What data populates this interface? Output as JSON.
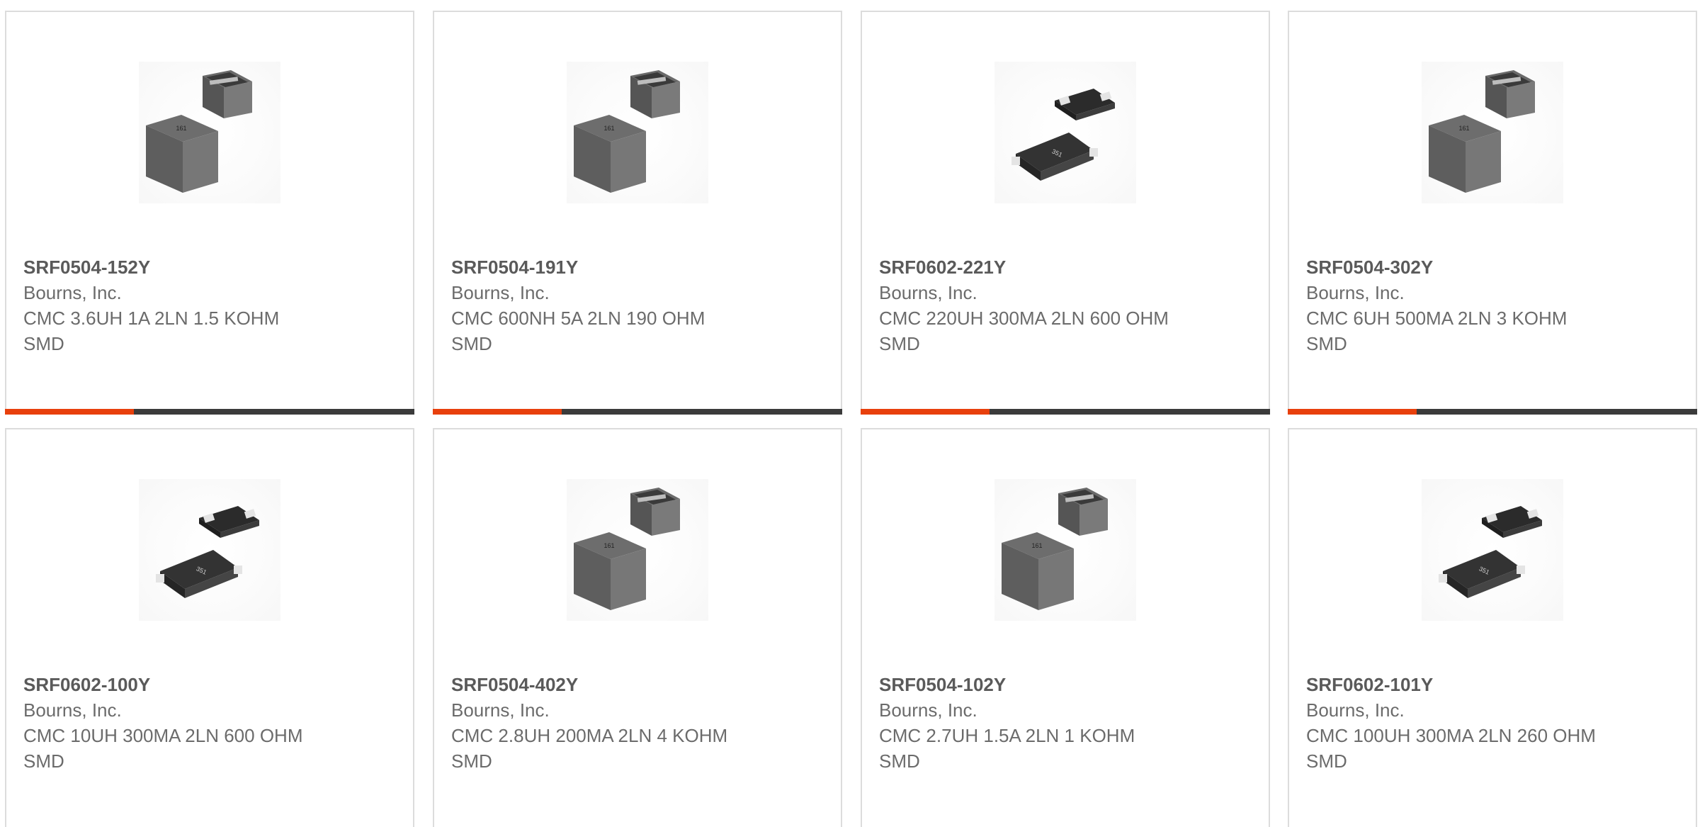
{
  "colors": {
    "accent": "#e8400c",
    "track": "#3b3b3b",
    "border": "#dcdcdc",
    "text": "#6b6b6b"
  },
  "products": [
    {
      "part_number": "SRF0504-152Y",
      "manufacturer": "Bourns, Inc.",
      "description": "CMC 3.6UH 1A 2LN 1.5 KOHM SMD",
      "image_icon": "inductor-cube-icon",
      "image_marking": "161"
    },
    {
      "part_number": "SRF0504-191Y",
      "manufacturer": "Bourns, Inc.",
      "description": "CMC 600NH 5A 2LN 190 OHM SMD",
      "image_icon": "inductor-cube-icon",
      "image_marking": "161"
    },
    {
      "part_number": "SRF0602-221Y",
      "manufacturer": "Bourns, Inc.",
      "description": "CMC 220UH 300MA 2LN 600 OHM SMD",
      "image_icon": "inductor-flat-icon",
      "image_marking": "351"
    },
    {
      "part_number": "SRF0504-302Y",
      "manufacturer": "Bourns, Inc.",
      "description": "CMC 6UH 500MA 2LN 3 KOHM SMD",
      "image_icon": "inductor-cube-icon",
      "image_marking": "161"
    },
    {
      "part_number": "SRF0602-100Y",
      "manufacturer": "Bourns, Inc.",
      "description": "CMC 10UH 300MA 2LN 600 OHM SMD",
      "image_icon": "inductor-flat-icon",
      "image_marking": "351"
    },
    {
      "part_number": "SRF0504-402Y",
      "manufacturer": "Bourns, Inc.",
      "description": "CMC 2.8UH 200MA 2LN 4 KOHM SMD",
      "image_icon": "inductor-cube-icon",
      "image_marking": "161"
    },
    {
      "part_number": "SRF0504-102Y",
      "manufacturer": "Bourns, Inc.",
      "description": "CMC 2.7UH 1.5A 2LN 1 KOHM SMD",
      "image_icon": "inductor-cube-icon",
      "image_marking": "161"
    },
    {
      "part_number": "SRF0602-101Y",
      "manufacturer": "Bourns, Inc.",
      "description": "CMC 100UH 300MA 2LN 260 OHM SMD",
      "image_icon": "inductor-flat-icon",
      "image_marking": "351"
    }
  ]
}
